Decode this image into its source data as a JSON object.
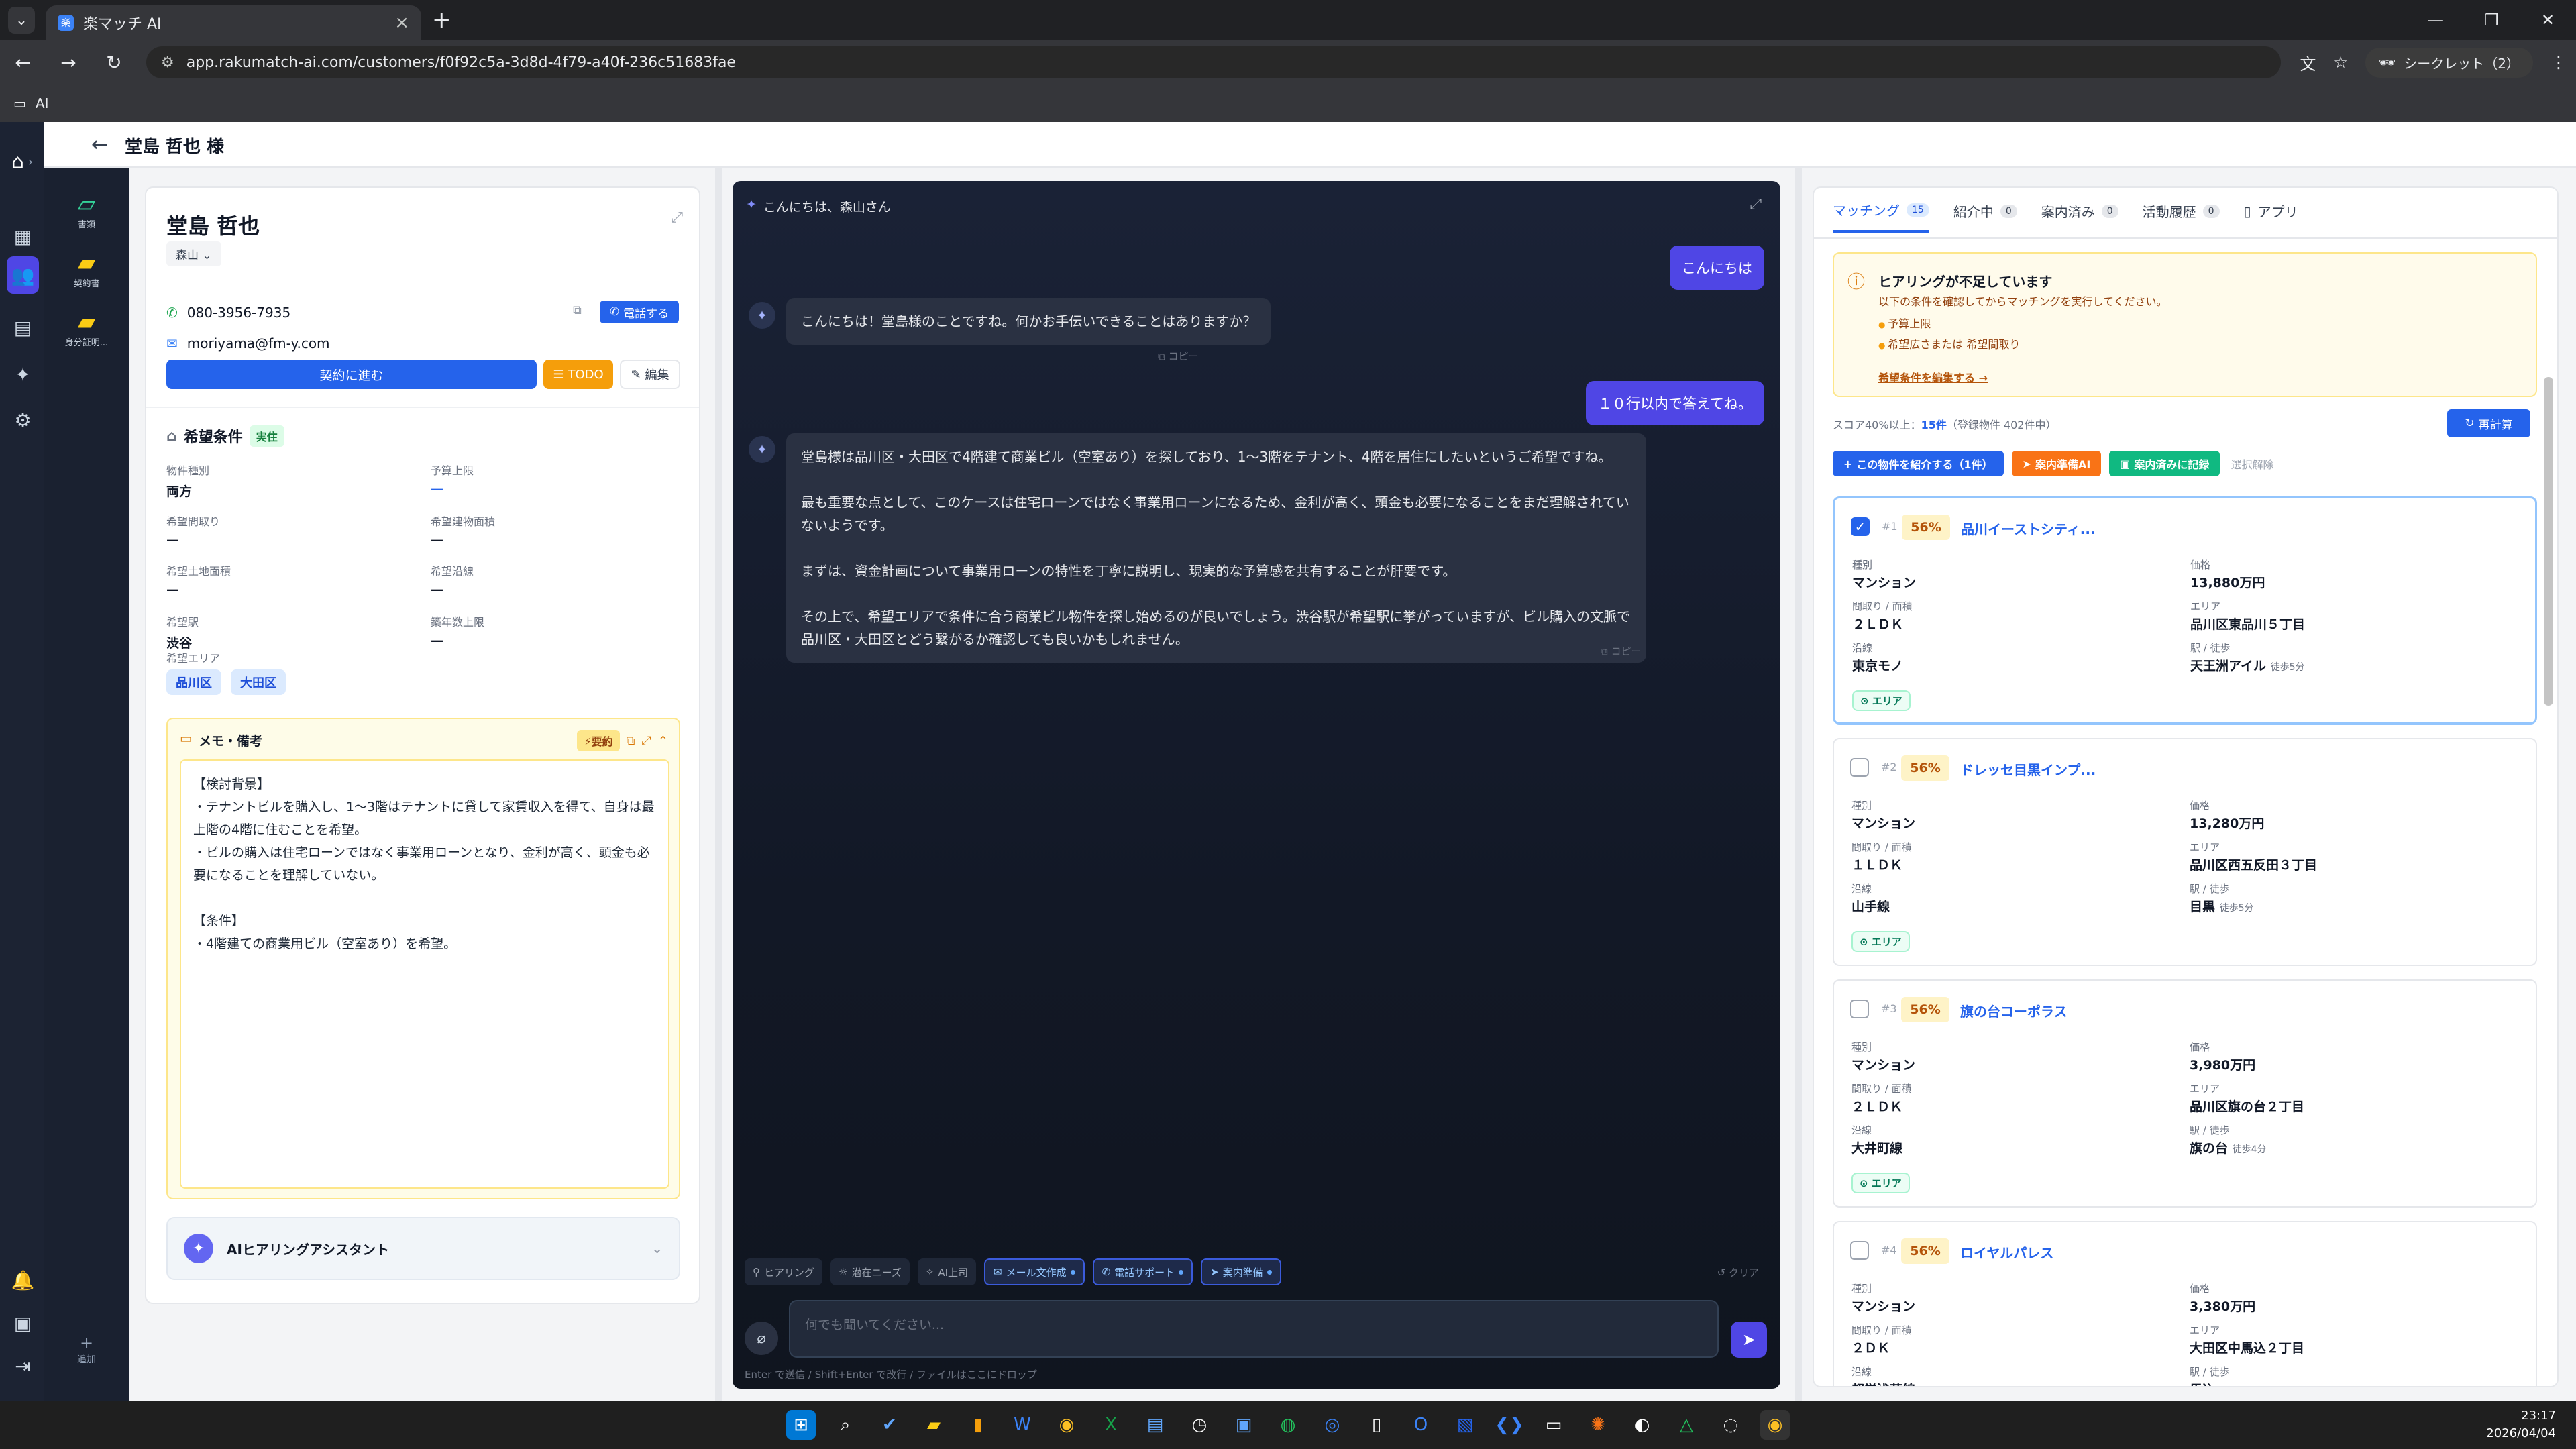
{
  "browser": {
    "tab_title": "楽マッチ AI",
    "url": "app.rakumatch-ai.com/customers/f0f92c5a-3d8d-4f79-a40f-236c51683fae",
    "incognito_label": "シークレット（2）",
    "bookmark_label": "AI"
  },
  "header": {
    "customer_title": "堂島 哲也 様"
  },
  "docs": [
    {
      "label": "書類"
    },
    {
      "label": "契約書"
    },
    {
      "label": "身分証明..."
    }
  ],
  "doc_add_label": "追加",
  "customer": {
    "name": "堂島 哲也",
    "agent": "森山",
    "phone": "080-3956-7935",
    "email": "moriyama@fm-y.com",
    "call_label": "電話する",
    "contract_label": "契約に進む",
    "todo_label": "TODO",
    "edit_label": "編集"
  },
  "conditions": {
    "title": "希望条件",
    "status": "実住",
    "fields": [
      {
        "label": "物件種別",
        "value": "両方"
      },
      {
        "label": "予算上限",
        "value": "—"
      },
      {
        "label": "希望間取り",
        "value": "—"
      },
      {
        "label": "希望建物面積",
        "value": "—"
      },
      {
        "label": "希望土地面積",
        "value": "—"
      },
      {
        "label": "希望沿線",
        "value": "—"
      },
      {
        "label": "希望駅",
        "value": "渋谷"
      },
      {
        "label": "築年数上限",
        "value": "—"
      }
    ],
    "area_label": "希望エリア",
    "areas": [
      "品川区",
      "大田区"
    ]
  },
  "memo": {
    "title": "メモ・備考",
    "summary_label": "要約",
    "body": "【検討背景】\n・テナントビルを購入し、1〜3階はテナントに貸して家賃収入を得て、自身は最上階の4階に住むことを希望。\n・ビルの購入は住宅ローンではなく事業用ローンとなり、金利が高く、頭金も必要になることを理解していない。\n\n【条件】\n・4階建ての商業用ビル（空室あり）を希望。"
  },
  "ai_assistant_label": "AIヒアリングアシスタント",
  "chat": {
    "greeting": "こんにちは、森山さん",
    "messages": [
      {
        "role": "user",
        "text": "こんにちは"
      },
      {
        "role": "ai",
        "text": "こんにちは！堂島様のことですね。何かお手伝いできることはありますか？"
      },
      {
        "role": "user",
        "text": "１０行以内で答えてね。"
      },
      {
        "role": "ai",
        "text": "堂島様は品川区・大田区で4階建て商業ビル（空室あり）を探しており、1〜3階をテナント、4階を居住にしたいというご希望ですね。\n\n最も重要な点として、このケースは住宅ローンではなく事業用ローンになるため、金利が高く、頭金も必要になることをまだ理解されていないようです。\n\nまずは、資金計画について事業用ローンの特性を丁寧に説明し、現実的な予算感を共有することが肝要です。\n\nその上で、希望エリアで条件に合う商業ビル物件を探し始めるのが良いでしょう。渋谷駅が希望駅に挙がっていますが、ビル購入の文脈で品川区・大田区とどう繋がるか確認しても良いかもしれません。"
      }
    ],
    "copy_label": "コピー",
    "quick_actions": [
      {
        "label": "ヒアリング",
        "active": false
      },
      {
        "label": "潜在ニーズ",
        "active": false
      },
      {
        "label": "AI上司",
        "active": false
      },
      {
        "label": "メール文作成",
        "active": true
      },
      {
        "label": "電話サポート",
        "active": true
      },
      {
        "label": "案内準備",
        "active": true
      }
    ],
    "clear_label": "クリア",
    "input_placeholder": "何でも聞いてください...",
    "hint": "Enter で送信 / Shift+Enter で改行 / ファイルはここにドロップ"
  },
  "right": {
    "tabs": [
      {
        "label": "マッチング",
        "count": "15"
      },
      {
        "label": "紹介中",
        "count": "0"
      },
      {
        "label": "案内済み",
        "count": "0"
      },
      {
        "label": "活動履歴",
        "count": "0"
      },
      {
        "label": "アプリ",
        "count": ""
      }
    ],
    "warning": {
      "title": "ヒアリングが不足しています",
      "sub": "以下の条件を確認してからマッチングを実行してください。",
      "items": [
        "予算上限",
        "希望広さまたは 希望間取り"
      ],
      "link": "希望条件を編集する →"
    },
    "score_prefix": "スコア40%以上：",
    "score_count": "15件",
    "score_suffix": "（登録物件 402件中）",
    "recalc_label": "再計算",
    "actions": {
      "introduce": "この物件を紹介する（1件）",
      "prep_ai": "案内準備AI",
      "record": "案内済みに記録",
      "deselect": "選択解除"
    },
    "labels": {
      "type": "種別",
      "price": "価格",
      "layout": "間取り / 面積",
      "area": "エリア",
      "line": "沿線",
      "station": "駅 / 徒歩",
      "area_badge": "エリア"
    },
    "properties": [
      {
        "rank": "#1",
        "score": "56%",
        "name": "品川イーストシティ...",
        "type": "マンション",
        "price": "13,880万円",
        "layout": "２ＬＤＫ",
        "area": "品川区東品川５丁目",
        "line": "東京モノ",
        "station": "天王洲アイル",
        "walk": "徒歩5分",
        "checked": true
      },
      {
        "rank": "#2",
        "score": "56%",
        "name": "ドレッセ目黒インプ...",
        "type": "マンション",
        "price": "13,280万円",
        "layout": "１ＬＤＫ",
        "area": "品川区西五反田３丁目",
        "line": "山手線",
        "station": "目黒",
        "walk": "徒歩5分",
        "checked": false
      },
      {
        "rank": "#3",
        "score": "56%",
        "name": "旗の台コーポラス",
        "type": "マンション",
        "price": "3,980万円",
        "layout": "２ＬＤＫ",
        "area": "品川区旗の台２丁目",
        "line": "大井町線",
        "station": "旗の台",
        "walk": "徒歩4分",
        "checked": false
      },
      {
        "rank": "#4",
        "score": "56%",
        "name": "ロイヤルパレス",
        "type": "マンション",
        "price": "3,380万円",
        "layout": "２ＤＫ",
        "area": "大田区中馬込２丁目",
        "line": "都営浅草線",
        "station": "馬込",
        "walk": "",
        "checked": false
      }
    ]
  },
  "taskbar": {
    "time": "23:17",
    "date": "2026/04/04"
  }
}
